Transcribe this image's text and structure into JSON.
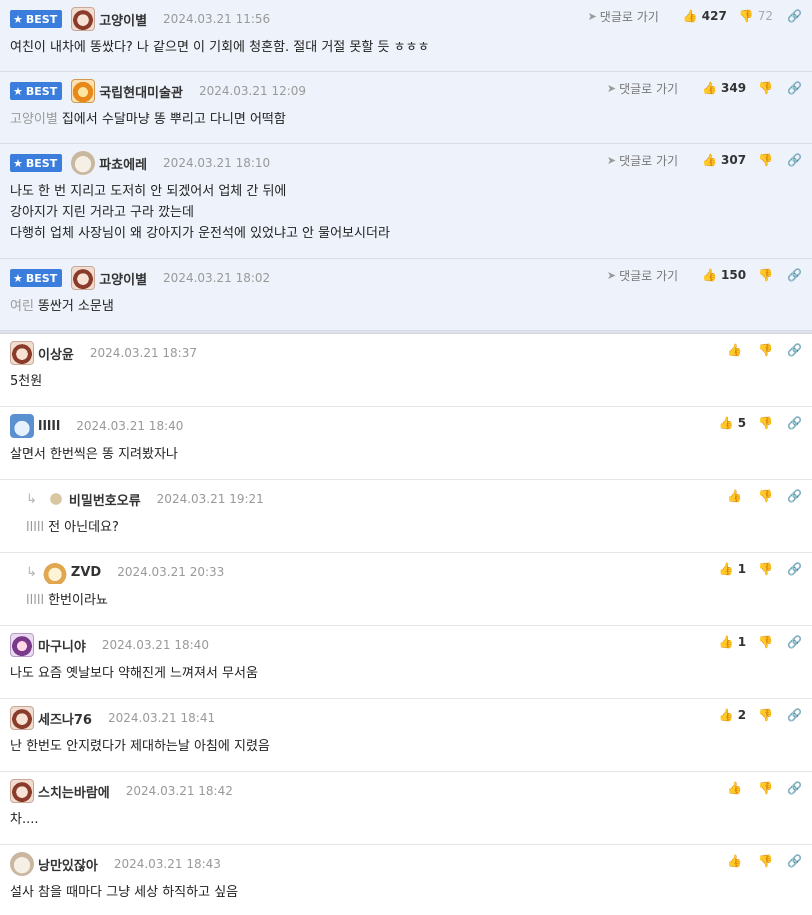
{
  "ui": {
    "goto_label": "댓글로 가기",
    "best_label": "BEST"
  },
  "best": [
    {
      "nick": "고양이별",
      "date": "2024.03.21 11:56",
      "avatar": "bear-icon",
      "up": "427",
      "down": "72",
      "text": [
        "여친이 내차에 똥쌌다? 나 같으면 이 기회에 청혼함. 절대 거절 못할 듯 ㅎㅎㅎ"
      ]
    },
    {
      "nick": "국립현대미술관",
      "date": "2024.03.21 12:09",
      "avatar": "tiger-icon",
      "up": "349",
      "down": "",
      "mention": "고양이별",
      "text": [
        "집에서 수달마냥 똥 뿌리고 다니면 어떡함"
      ]
    },
    {
      "nick": "파쵸에레",
      "date": "2024.03.21 18:10",
      "avatar": "puppy-icon",
      "up": "307",
      "down": "",
      "text": [
        "나도 한 번 지리고 도저히 안 되겠어서 업체 간 뒤에",
        "강아지가 지린 거라고 구라 깠는데",
        "다행히 업체 사장님이 왜 강아지가 운전석에 있었냐고 안 물어보시더라"
      ]
    },
    {
      "nick": "고양이별",
      "date": "2024.03.21 18:02",
      "avatar": "bear-icon",
      "up": "150",
      "down": "",
      "mention": "여린",
      "text": [
        "똥싼거 소문냄"
      ]
    }
  ],
  "comments": [
    {
      "nick": "이상윤",
      "date": "2024.03.21 18:37",
      "avatar": "bear-icon",
      "up": "",
      "text": "5천원"
    },
    {
      "nick": "lllll",
      "date": "2024.03.21 18:40",
      "avatar": "seal-icon",
      "up": "5",
      "text": "살면서 한번씩은 똥 지려봤자나"
    },
    {
      "nick": "비밀번호오류",
      "date": "2024.03.21 19:21",
      "avatar": "bug-icon",
      "up": "",
      "mention": "lllll",
      "text": "전 아닌데요?",
      "reply": true
    },
    {
      "nick": "ZVD",
      "date": "2024.03.21 20:33",
      "avatar": "fox-icon",
      "up": "1",
      "mention": "lllll",
      "text": "한번이라뇨",
      "reply": true
    },
    {
      "nick": "마구니야",
      "date": "2024.03.21 18:40",
      "avatar": "mix-icon",
      "up": "1",
      "text": "나도 요즘 옛날보다 약해진게 느껴져서 무서움"
    },
    {
      "nick": "세즈나76",
      "date": "2024.03.21 18:41",
      "avatar": "bear-icon",
      "up": "2",
      "text": "난 한번도 안지렸다가 제대하는날 아침에 지렸음"
    },
    {
      "nick": "스치는바람에",
      "date": "2024.03.21 18:42",
      "avatar": "bear-icon",
      "up": "",
      "text": "차...."
    },
    {
      "nick": "낭만있잖아",
      "date": "2024.03.21 18:43",
      "avatar": "puppy-icon",
      "up": "",
      "text": "설사 참을 때마다 그냥 세상 하직하고 싶음"
    }
  ]
}
